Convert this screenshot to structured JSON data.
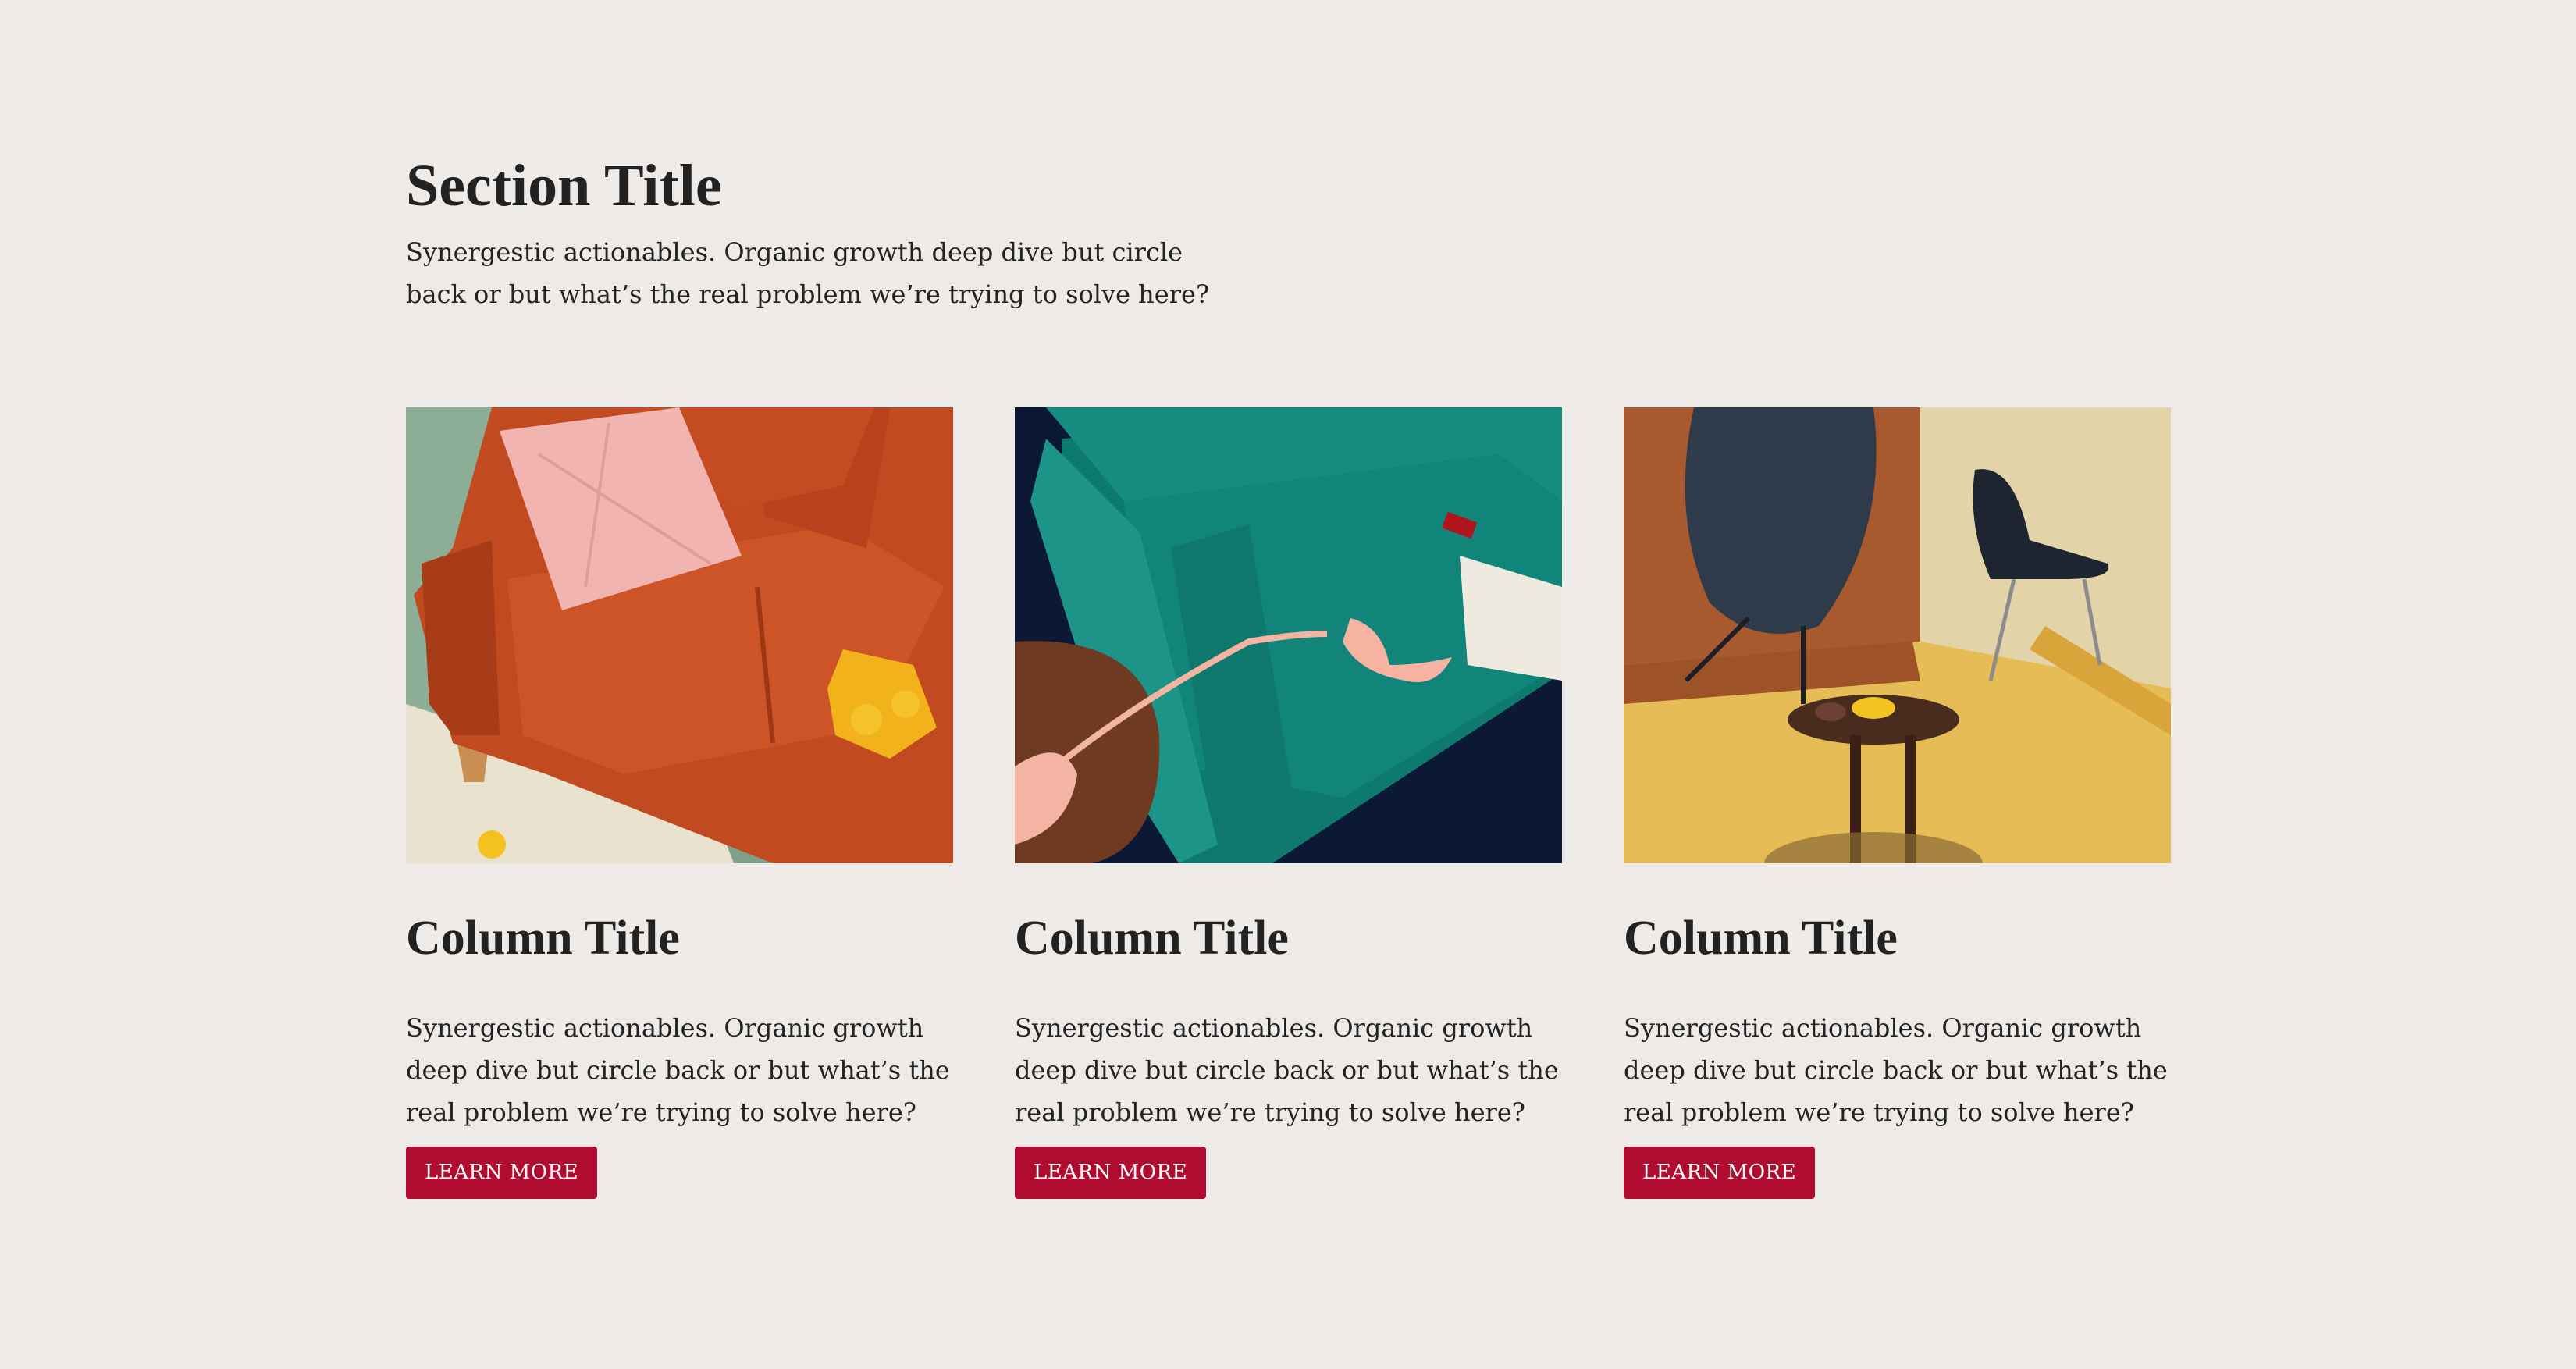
{
  "section": {
    "title": "Section Title",
    "description": "Synergestic actionables. Organic growth deep dive but circle back or but what’s the real problem we’re trying to solve here?"
  },
  "columns": [
    {
      "image": "orange-sofa-photo",
      "title": "Column Title",
      "text": "Synergestic actionables. Organic growth deep dive but circle back or but what’s the real problem we’re trying to solve here?",
      "button_label": "LEARN MORE"
    },
    {
      "image": "teal-sofa-with-phone-photo",
      "title": "Column Title",
      "text": "Synergestic actionables. Organic growth deep dive but circle back or but what’s the real problem we’re trying to solve here?",
      "button_label": "LEARN MORE"
    },
    {
      "image": "chairs-and-side-table-photo",
      "title": "Column Title",
      "text": "Synergestic actionables. Organic growth deep dive but circle back or but what’s the real problem we’re trying to solve here?",
      "button_label": "LEARN MORE"
    }
  ],
  "colors": {
    "background": "#EEEAE7",
    "button": "#B00C30",
    "text": "#222222"
  }
}
